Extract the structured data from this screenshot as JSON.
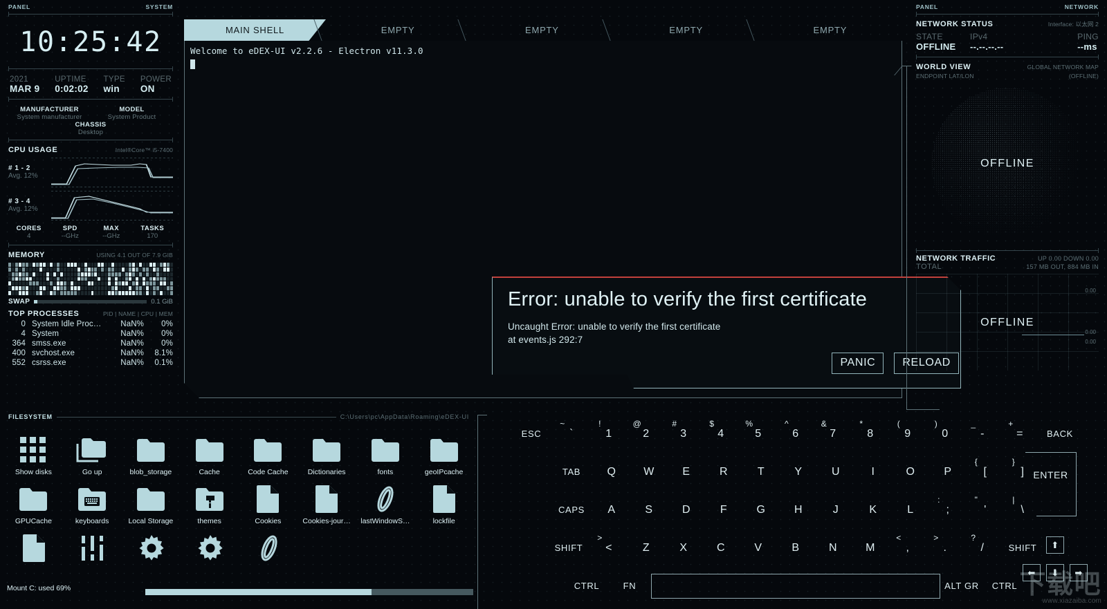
{
  "left_panel": {
    "header_left": "PANEL",
    "header_right": "SYSTEM",
    "clock": "10:25:42",
    "system": [
      {
        "key": "2021",
        "value": "MAR 9"
      },
      {
        "key": "UPTIME",
        "value": "0:02:02"
      },
      {
        "key": "TYPE",
        "value": "win"
      },
      {
        "key": "POWER",
        "value": "ON"
      }
    ],
    "hardware": [
      {
        "key": "MANUFACTURER",
        "value": "System manufacturer"
      },
      {
        "key": "MODEL",
        "value": "System Product"
      },
      {
        "key": "CHASSIS",
        "value": "Desktop"
      }
    ],
    "cpu": {
      "title": "CPU USAGE",
      "model": "Intel®Core™ i5-7400",
      "blocks": [
        {
          "name": "# 1 - 2",
          "avg": "Avg. 12%"
        },
        {
          "name": "# 3 - 4",
          "avg": "Avg. 12%"
        }
      ],
      "stats": [
        {
          "key": "CORES",
          "value": "4"
        },
        {
          "key": "SPD",
          "value": "--GHz"
        },
        {
          "key": "MAX",
          "value": "--GHz"
        },
        {
          "key": "TASKS",
          "value": "170"
        }
      ]
    },
    "memory": {
      "title": "MEMORY",
      "usage": "USING 4.1 OUT OF 7.9 GIB",
      "swap_label": "SWAP",
      "swap_value": "0.1 GiB",
      "swap_percent": 3
    },
    "processes": {
      "title": "TOP PROCESSES",
      "columns": "PID | NAME | CPU | MEM",
      "rows": [
        {
          "pid": "0",
          "name": "System Idle Proc…",
          "cpu": "NaN%",
          "mem": "0%"
        },
        {
          "pid": "4",
          "name": "System",
          "cpu": "NaN%",
          "mem": "0%"
        },
        {
          "pid": "364",
          "name": "smss.exe",
          "cpu": "NaN%",
          "mem": "0%"
        },
        {
          "pid": "400",
          "name": "svchost.exe",
          "cpu": "NaN%",
          "mem": "8.1%"
        },
        {
          "pid": "552",
          "name": "csrss.exe",
          "cpu": "NaN%",
          "mem": "0.1%"
        }
      ]
    }
  },
  "terminal": {
    "tabs": [
      {
        "label": "MAIN SHELL",
        "active": true
      },
      {
        "label": "EMPTY",
        "active": false
      },
      {
        "label": "EMPTY",
        "active": false
      },
      {
        "label": "EMPTY",
        "active": false
      },
      {
        "label": "EMPTY",
        "active": false
      }
    ],
    "output": "Welcome to eDEX-UI v2.2.6 - Electron v11.3.0"
  },
  "modal": {
    "title": "Error: unable to verify the first certificate",
    "message_line1": "Uncaught Error: unable to verify the first certificate",
    "message_line2": "at events.js 292:7",
    "panic_label": "PANIC",
    "reload_label": "RELOAD",
    "accent_color": "#c3413c"
  },
  "right_panel": {
    "header_left": "PANEL",
    "header_right": "NETWORK",
    "network_status": {
      "title": "NETWORK STATUS",
      "interface": "Interface: 以太网 2",
      "fields": [
        {
          "key": "STATE",
          "value": "OFFLINE"
        },
        {
          "key": "IPv4",
          "value": "--.--.--.--"
        },
        {
          "key": "PING",
          "value": "--ms"
        }
      ]
    },
    "world_view": {
      "title": "WORLD VIEW",
      "subtitle": "GLOBAL NETWORK MAP",
      "endpoint_label": "ENDPOINT LAT/LON",
      "endpoint_value": "(OFFLINE)",
      "globe_status": "OFFLINE"
    },
    "traffic": {
      "title": "NETWORK TRAFFIC",
      "rate": "UP 0.00 DOWN 0.00",
      "total_label": "TOTAL",
      "total_value": "157 MB OUT, 884 MB IN",
      "chart_status": "OFFLINE",
      "axis_labels": [
        "0.00",
        "0.00",
        "0.00"
      ]
    }
  },
  "filesystem": {
    "title": "FILESYSTEM",
    "path": "C:\\Users\\pc\\AppData\\Roaming\\eDEX-UI",
    "mount_label": "Mount C: used 69%",
    "mount_percent": 69,
    "items": [
      {
        "name": "Show disks",
        "icon": "disks-icon"
      },
      {
        "name": "Go up",
        "icon": "go-up-folder-icon"
      },
      {
        "name": "blob_storage",
        "icon": "folder-icon"
      },
      {
        "name": "Cache",
        "icon": "folder-icon"
      },
      {
        "name": "Code Cache",
        "icon": "folder-icon"
      },
      {
        "name": "Dictionaries",
        "icon": "folder-icon"
      },
      {
        "name": "fonts",
        "icon": "folder-icon"
      },
      {
        "name": "geoIPcache",
        "icon": "folder-icon"
      },
      {
        "name": "GPUCache",
        "icon": "folder-icon"
      },
      {
        "name": "keyboards",
        "icon": "keyboard-folder-icon"
      },
      {
        "name": "Local Storage",
        "icon": "folder-icon"
      },
      {
        "name": "themes",
        "icon": "theme-folder-icon"
      },
      {
        "name": "Cookies",
        "icon": "file-icon"
      },
      {
        "name": "Cookies-jour…",
        "icon": "file-icon"
      },
      {
        "name": "lastWindowS…",
        "icon": "ellipse-file-icon"
      },
      {
        "name": "lockfile",
        "icon": "file-icon"
      },
      {
        "name": "",
        "icon": "file-icon"
      },
      {
        "name": "",
        "icon": "sliders-icon"
      },
      {
        "name": "",
        "icon": "gear-icon"
      },
      {
        "name": "",
        "icon": "gear-icon"
      },
      {
        "name": "",
        "icon": "ellipse-file-icon"
      }
    ]
  },
  "keyboard": {
    "row1": [
      {
        "main": "ESC",
        "sup": "",
        "small": true
      },
      {
        "main": "`",
        "sup": "~"
      },
      {
        "main": "1",
        "sup": "!"
      },
      {
        "main": "2",
        "sup": "@"
      },
      {
        "main": "3",
        "sup": "#"
      },
      {
        "main": "4",
        "sup": "$"
      },
      {
        "main": "5",
        "sup": "%"
      },
      {
        "main": "6",
        "sup": "^"
      },
      {
        "main": "7",
        "sup": "&"
      },
      {
        "main": "8",
        "sup": "*"
      },
      {
        "main": "9",
        "sup": "("
      },
      {
        "main": "0",
        "sup": ")"
      },
      {
        "main": "-",
        "sup": "_"
      },
      {
        "main": "=",
        "sup": "+"
      },
      {
        "main": "BACK",
        "sup": "",
        "small": true
      }
    ],
    "row2": [
      {
        "main": "TAB",
        "sup": "",
        "small": true
      },
      {
        "main": "Q",
        "sup": ""
      },
      {
        "main": "W",
        "sup": ""
      },
      {
        "main": "E",
        "sup": ""
      },
      {
        "main": "R",
        "sup": ""
      },
      {
        "main": "T",
        "sup": ""
      },
      {
        "main": "Y",
        "sup": ""
      },
      {
        "main": "U",
        "sup": ""
      },
      {
        "main": "I",
        "sup": ""
      },
      {
        "main": "O",
        "sup": ""
      },
      {
        "main": "P",
        "sup": ""
      },
      {
        "main": "[",
        "sup": "{"
      },
      {
        "main": "]",
        "sup": "}"
      }
    ],
    "row3": [
      {
        "main": "CAPS",
        "sup": "",
        "small": true
      },
      {
        "main": "A",
        "sup": ""
      },
      {
        "main": "S",
        "sup": ""
      },
      {
        "main": "D",
        "sup": ""
      },
      {
        "main": "F",
        "sup": ""
      },
      {
        "main": "G",
        "sup": ""
      },
      {
        "main": "H",
        "sup": ""
      },
      {
        "main": "J",
        "sup": ""
      },
      {
        "main": "K",
        "sup": ""
      },
      {
        "main": "L",
        "sup": ""
      },
      {
        "main": ";",
        "sup": ":"
      },
      {
        "main": "'",
        "sup": "\""
      },
      {
        "main": "\\",
        "sup": "|"
      }
    ],
    "row4": [
      {
        "main": "SHIFT",
        "sup": "",
        "small": true
      },
      {
        "main": "<",
        "sup": ">"
      },
      {
        "main": "Z",
        "sup": ""
      },
      {
        "main": "X",
        "sup": ""
      },
      {
        "main": "C",
        "sup": ""
      },
      {
        "main": "V",
        "sup": ""
      },
      {
        "main": "B",
        "sup": ""
      },
      {
        "main": "N",
        "sup": ""
      },
      {
        "main": "M",
        "sup": ""
      },
      {
        "main": ",",
        "sup": "<"
      },
      {
        "main": ".",
        "sup": ">"
      },
      {
        "main": "/",
        "sup": "?"
      },
      {
        "main": "SHIFT",
        "sup": "",
        "small": true
      }
    ],
    "row5": [
      {
        "main": "CTRL",
        "sup": "",
        "small": true
      },
      {
        "main": "FN",
        "sup": "",
        "small": true
      },
      {
        "main": "",
        "sup": "",
        "space": true
      },
      {
        "main": "ALT GR",
        "sup": "",
        "small": true
      },
      {
        "main": "CTRL",
        "sup": "",
        "small": true
      }
    ],
    "enter_label": "ENTER",
    "arrow_up": "⬆",
    "arrow_left": "⬅",
    "arrow_down": "⬇",
    "arrow_right": "➡"
  },
  "watermark": {
    "big": "下载吧",
    "small": "www.xiazaiba.com"
  }
}
